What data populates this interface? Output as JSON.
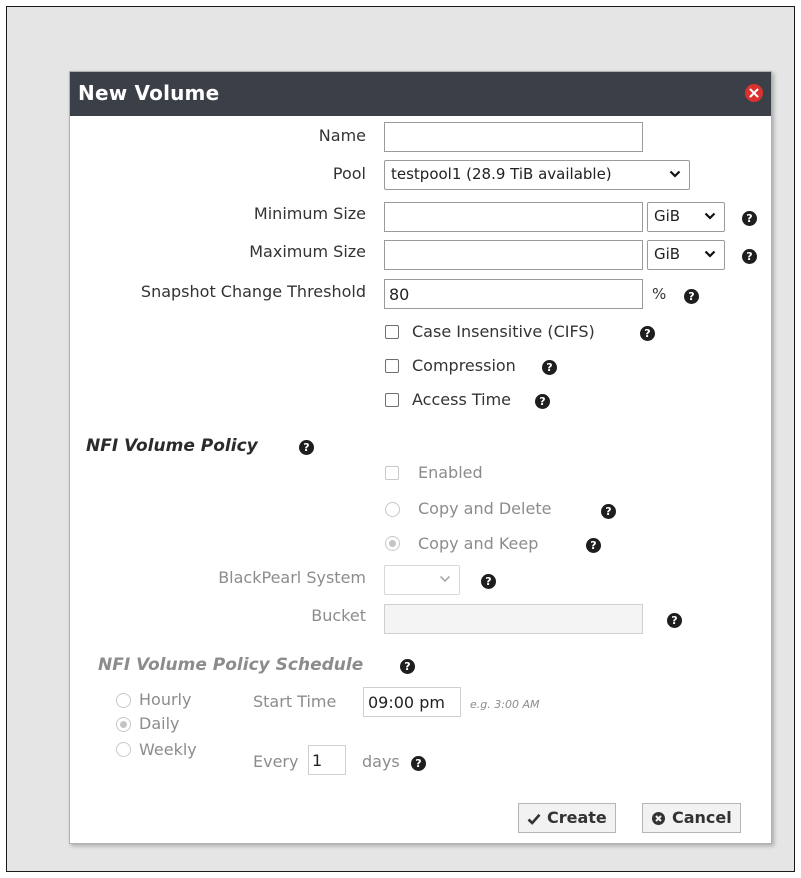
{
  "dialog": {
    "title": "New Volume"
  },
  "form": {
    "name_label": "Name",
    "name_value": "",
    "pool_label": "Pool",
    "pool_selected": "testpool1 (28.9 TiB available)",
    "min_size_label": "Minimum Size",
    "min_size_value": "",
    "min_size_unit": "GiB",
    "max_size_label": "Maximum Size",
    "max_size_value": "",
    "max_size_unit": "GiB",
    "snapshot_label": "Snapshot Change Threshold",
    "snapshot_value": "80",
    "snapshot_unit": "%",
    "case_insensitive_label": "Case Insensitive (CIFS)",
    "compression_label": "Compression",
    "access_time_label": "Access Time"
  },
  "nfi_policy": {
    "heading": "NFI Volume Policy",
    "enabled_label": "Enabled",
    "copy_delete_label": "Copy and Delete",
    "copy_keep_label": "Copy and Keep",
    "selected_mode": "Copy and Keep",
    "blackpearl_label": "BlackPearl System",
    "blackpearl_selected": "",
    "bucket_label": "Bucket",
    "bucket_value": ""
  },
  "schedule": {
    "heading": "NFI Volume Policy Schedule",
    "hourly_label": "Hourly",
    "daily_label": "Daily",
    "weekly_label": "Weekly",
    "selected_frequency": "Daily",
    "start_time_label": "Start Time",
    "start_time_value": "09:00 pm",
    "start_time_hint": "e.g. 3:00 AM",
    "every_label": "Every",
    "every_value": "1",
    "days_label": "days"
  },
  "buttons": {
    "create": "Create",
    "cancel": "Cancel"
  },
  "icons": {
    "help": "question-circle-icon",
    "close": "close-circle-icon",
    "create": "check-icon",
    "cancel": "cancel-circle-icon",
    "dropdown": "chevron-down-icon"
  },
  "colors": {
    "titlebar": "#3a3f48",
    "close": "#d9322f",
    "disabled_text": "#8c8c8c"
  }
}
